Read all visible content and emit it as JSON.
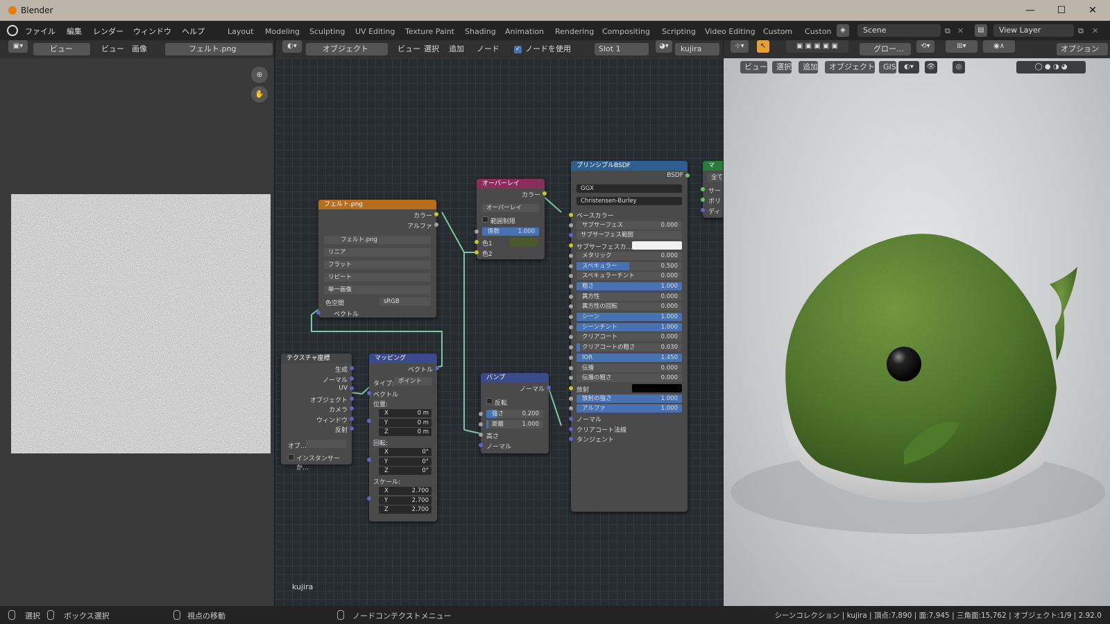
{
  "window": {
    "app": "Blender",
    "min": "—",
    "max": "☐",
    "close": "✕"
  },
  "menus": [
    "ファイル",
    "編集",
    "レンダー",
    "ウィンドウ",
    "ヘルプ"
  ],
  "workspaces": [
    "Layout",
    "Modeling",
    "Sculpting",
    "UV Editing",
    "Texture Paint",
    "Shading",
    "Animation",
    "Rendering",
    "Compositing",
    "Scripting",
    "Video Editing",
    "Custom",
    "Custon"
  ],
  "scene": "Scene",
  "view_layer": "View Layer",
  "image_editor": {
    "view": "ビュー",
    "menus": [
      "ビュー",
      "画像"
    ],
    "image": "フェルト.png"
  },
  "node_editor": {
    "mode": "オブジェクト",
    "menus": [
      "ビュー",
      "選択",
      "追加",
      "ノード"
    ],
    "use_nodes": "ノードを使用",
    "slot": "Slot 1",
    "material": "kujira",
    "label": "kujira"
  },
  "viewport_header": {
    "orient": "グロー…",
    "options": "オプション",
    "menus": [
      "ビュー",
      "選択",
      "追加",
      "オブジェクト",
      "GIS"
    ]
  },
  "nodes": {
    "image": {
      "title": "フェルト.png",
      "out_color": "カラー",
      "out_alpha": "アルファ",
      "file": "フェルト.png",
      "interp": "リニア",
      "proj": "フラット",
      "ext": "リピート",
      "src": "単一画像",
      "cs_label": "色空間",
      "cs": "sRGB",
      "in_vector": "ベクトル"
    },
    "texcoord": {
      "title": "テクスチャ座標",
      "outs": [
        "生成",
        "ノーマル",
        "UV",
        "オブジェクト",
        "カメラ",
        "ウィンドウ",
        "反射"
      ],
      "obj": "オブ…",
      "inst": "インスタンサーか…"
    },
    "mapping": {
      "title": "マッピング",
      "out": "ベクトル",
      "type_label": "タイプ:",
      "type": "ポイント",
      "in_vec": "ベクトル",
      "loc": "位置:",
      "rot": "回転:",
      "scale": "スケール:",
      "loc_vals": [
        [
          "X",
          "0 m"
        ],
        [
          "Y",
          "0 m"
        ],
        [
          "Z",
          "0 m"
        ]
      ],
      "rot_vals": [
        [
          "X",
          "0°"
        ],
        [
          "Y",
          "0°"
        ],
        [
          "Z",
          "0°"
        ]
      ],
      "scale_vals": [
        [
          "X",
          "2.700"
        ],
        [
          "Y",
          "2.700"
        ],
        [
          "Z",
          "2.700"
        ]
      ]
    },
    "overlay": {
      "title": "オーバーレイ",
      "out": "カラー",
      "blend": "オーバーレイ",
      "clamp": "範囲制限",
      "fac_label": "係数",
      "fac": "1.000",
      "c1": "色1",
      "c2": "色2",
      "c1_color": "#4a5a2a"
    },
    "bump": {
      "title": "バンプ",
      "out": "ノーマル",
      "invert": "反転",
      "str_label": "強さ",
      "str": "0.200",
      "dist_label": "距離",
      "dist": "1.000",
      "height": "高さ",
      "normal": "ノーマル",
      "strength": 0.2
    },
    "bsdf": {
      "title": "プリンシプルBSDF",
      "out": "BSDF",
      "dist": "GGX",
      "ss": "Christensen-Burley",
      "rows": [
        {
          "t": "label",
          "l": "ベースカラー",
          "s": "y"
        },
        {
          "t": "num",
          "l": "サブサーフェス",
          "v": "0.000",
          "s": "g"
        },
        {
          "t": "drop",
          "l": "サブサーフェス範囲",
          "s": "p"
        },
        {
          "t": "color",
          "l": "サブサーフェスカ…",
          "s": "y",
          "c": "#f2f2f2"
        },
        {
          "t": "num",
          "l": "メタリック",
          "v": "0.000",
          "s": "g"
        },
        {
          "t": "num",
          "l": "スペキュラー",
          "v": "0.500",
          "s": "g",
          "f": 0.5
        },
        {
          "t": "num",
          "l": "スペキュラーチント",
          "v": "0.000",
          "s": "g"
        },
        {
          "t": "num",
          "l": "粗さ",
          "v": "1.000",
          "s": "g",
          "f": 1
        },
        {
          "t": "num",
          "l": "異方性",
          "v": "0.000",
          "s": "g"
        },
        {
          "t": "num",
          "l": "異方性の回転",
          "v": "0.000",
          "s": "g"
        },
        {
          "t": "num",
          "l": "シーン",
          "v": "1.000",
          "s": "g",
          "f": 1
        },
        {
          "t": "num",
          "l": "シーンチント",
          "v": "1.000",
          "s": "g",
          "f": 1
        },
        {
          "t": "num",
          "l": "クリアコート",
          "v": "0.000",
          "s": "g"
        },
        {
          "t": "num",
          "l": "クリアコートの粗さ",
          "v": "0.030",
          "s": "g",
          "f": 0.03
        },
        {
          "t": "num",
          "l": "IOR",
          "v": "1.450",
          "s": "g",
          "f": 1
        },
        {
          "t": "num",
          "l": "伝播",
          "v": "0.000",
          "s": "g"
        },
        {
          "t": "num",
          "l": "伝播の粗さ",
          "v": "0.000",
          "s": "g"
        },
        {
          "t": "color",
          "l": "放射",
          "s": "y",
          "c": "#000000"
        },
        {
          "t": "num",
          "l": "放射の強さ",
          "v": "1.000",
          "s": "g",
          "f": 1
        },
        {
          "t": "num",
          "l": "アルファ",
          "v": "1.000",
          "s": "g",
          "f": 1
        },
        {
          "t": "label",
          "l": "ノーマル",
          "s": "p"
        },
        {
          "t": "label",
          "l": "クリアコート法線",
          "s": "p"
        },
        {
          "t": "label",
          "l": "タンジェント",
          "s": "p"
        }
      ]
    },
    "output": {
      "title": "マ",
      "b1": "全て",
      "rows": [
        "サー",
        "ボリ",
        "ディ"
      ]
    }
  },
  "status": {
    "select": "選択",
    "box": "ボックス選択",
    "move": "視点の移動",
    "ctx": "ノードコンテクストメニュー",
    "info": "シーンコレクション | kujira | 頂点:7,890 | 面:7,945 | 三角面:15,762 | オブジェクト:1/9 | 2.92.0"
  }
}
